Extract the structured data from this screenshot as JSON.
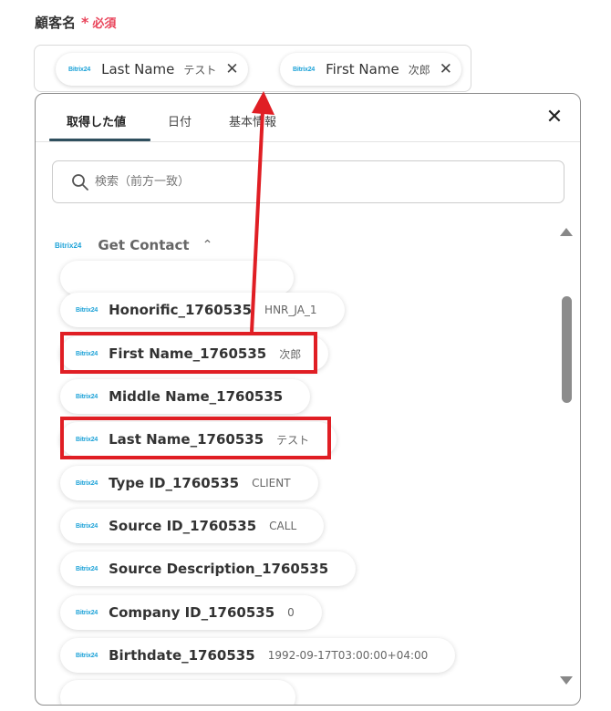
{
  "field": {
    "label": "顧客名",
    "required_star": "*",
    "required_text": "必須"
  },
  "tokens": [
    {
      "logo": "Bitrix24",
      "name": "Last Name",
      "value": "テスト",
      "remove": "✕"
    },
    {
      "logo": "Bitrix24",
      "name": "First Name",
      "value": "次郎",
      "remove": "✕"
    }
  ],
  "tabs": [
    {
      "label": "取得した値"
    },
    {
      "label": "日付"
    },
    {
      "label": "基本情報"
    }
  ],
  "close_glyph": "✕",
  "search": {
    "placeholder": "検索（前方一致）"
  },
  "group": {
    "logo": "Bitrix24",
    "title": "Get Contact",
    "chevron": "⌃"
  },
  "items": [
    {
      "logo": "Bitrix24",
      "name": "Honorific_1760535",
      "value": "HNR_JA_1"
    },
    {
      "logo": "Bitrix24",
      "name": "First Name_1760535",
      "value": "次郎"
    },
    {
      "logo": "Bitrix24",
      "name": "Middle Name_1760535",
      "value": ""
    },
    {
      "logo": "Bitrix24",
      "name": "Last Name_1760535",
      "value": "テスト"
    },
    {
      "logo": "Bitrix24",
      "name": "Type ID_1760535",
      "value": "CLIENT"
    },
    {
      "logo": "Bitrix24",
      "name": "Source ID_1760535",
      "value": "CALL"
    },
    {
      "logo": "Bitrix24",
      "name": "Source Description_1760535",
      "value": ""
    },
    {
      "logo": "Bitrix24",
      "name": "Company ID_1760535",
      "value": "0"
    },
    {
      "logo": "Bitrix24",
      "name": "Birthdate_1760535",
      "value": "1992-09-17T03:00:00+04:00"
    }
  ],
  "colors": {
    "highlight": "#e01e24",
    "required": "#e9445a",
    "logo": "#1fa3d8",
    "tab_underline": "#2f4f5e"
  }
}
